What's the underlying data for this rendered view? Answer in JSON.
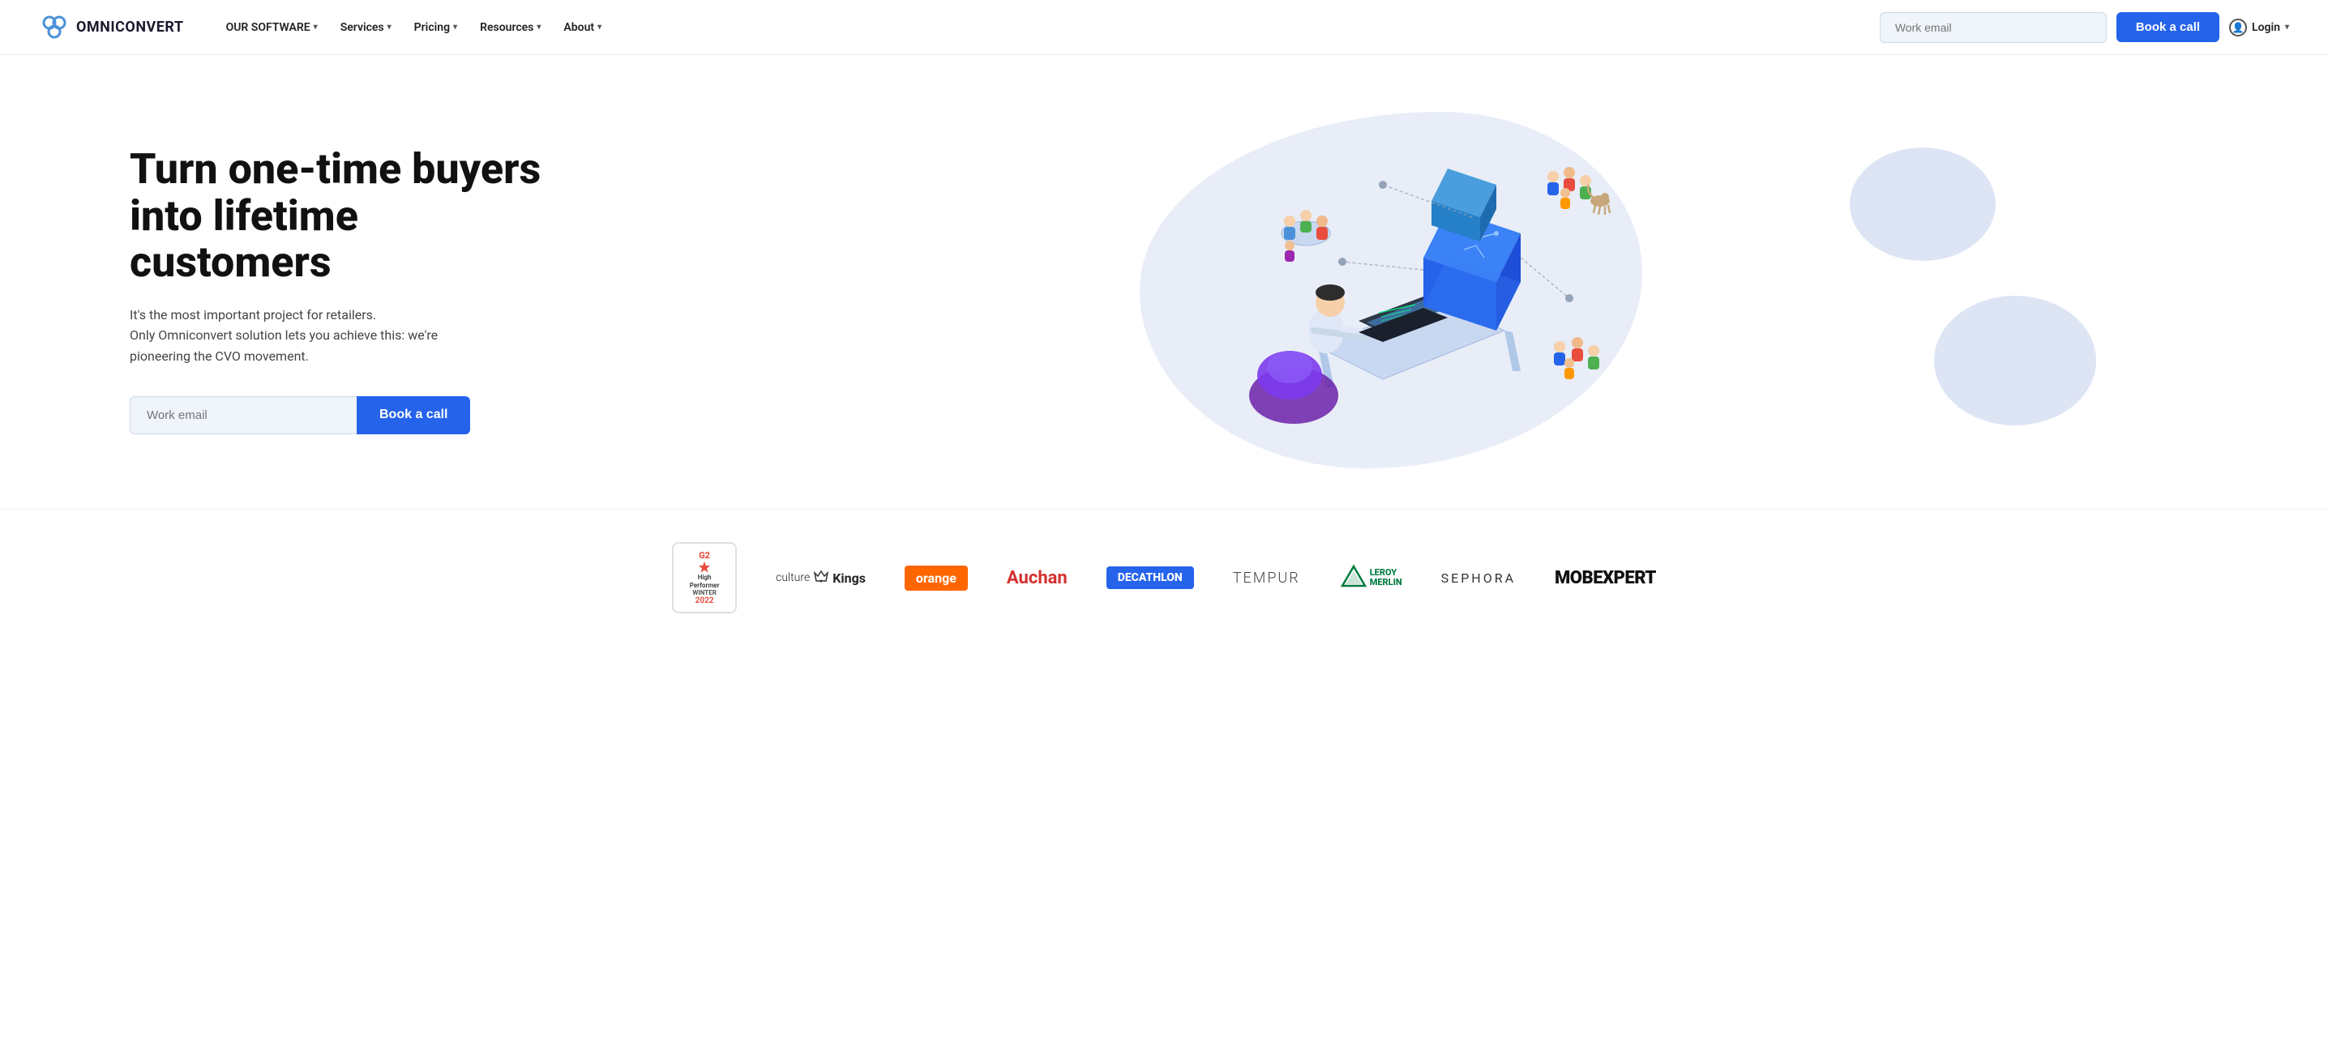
{
  "site": {
    "logo_text": "OMNICONVERT",
    "tagline": "Turn one-time buyers into lifetime customers",
    "subtitle_line1": "It's the most important project for retailers.",
    "subtitle_line2": "Only Omniconvert solution lets you achieve this: we're",
    "subtitle_line3": "pioneering the CVO movement.",
    "email_placeholder_hero": "Work email",
    "email_placeholder_nav": "Work email",
    "book_call_label": "Book a call",
    "login_label": "Login"
  },
  "nav": {
    "items": [
      {
        "label": "OUR SOFTWARE",
        "has_dropdown": true
      },
      {
        "label": "Services",
        "has_dropdown": true
      },
      {
        "label": "Pricing",
        "has_dropdown": true
      },
      {
        "label": "Resources",
        "has_dropdown": true
      },
      {
        "label": "About",
        "has_dropdown": true
      }
    ]
  },
  "logos": [
    {
      "id": "g2-badge",
      "type": "badge",
      "g2_label": "G2",
      "high_performer": "High Performer",
      "season": "WINTER",
      "year": "2022"
    },
    {
      "id": "culture-kings",
      "type": "text",
      "text": "culture Kings",
      "style": "culture-kings"
    },
    {
      "id": "orange",
      "type": "text",
      "text": "orange",
      "style": "orange-brand"
    },
    {
      "id": "auchan",
      "type": "text",
      "text": "Auchan",
      "style": "brand-logo"
    },
    {
      "id": "decathlon",
      "type": "text",
      "text": "DECATHLON",
      "style": "decathlon-brand"
    },
    {
      "id": "tempur",
      "type": "text",
      "text": "TEMPUR",
      "style": "tempur-brand"
    },
    {
      "id": "leroy-merlin",
      "type": "text",
      "text": "LEROY MERLIN",
      "style": "leroy-brand"
    },
    {
      "id": "sephora",
      "type": "text",
      "text": "SEPHORA",
      "style": "sephora-brand"
    },
    {
      "id": "mobexpert",
      "type": "text",
      "text": "MOBEXPERT",
      "style": "mobexpert-brand"
    }
  ],
  "colors": {
    "primary_blue": "#2563eb",
    "nav_bg": "#ffffff",
    "hero_bg": "#ffffff",
    "input_bg": "#f0f4fb",
    "blob_color": "#e8edf8"
  }
}
